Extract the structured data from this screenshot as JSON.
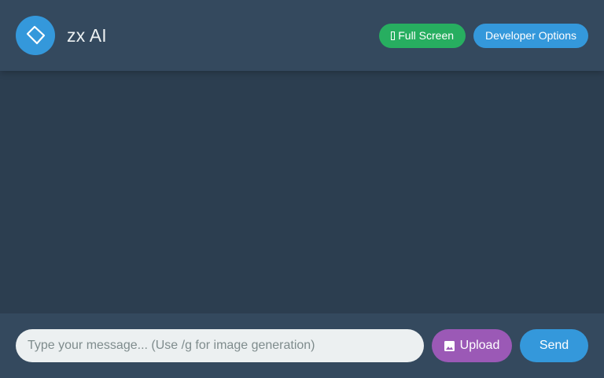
{
  "header": {
    "logo_icon": "diamond-logo-icon",
    "title": "zx AI",
    "fullscreen_label": "Full Screen",
    "fullscreen_icon": "fullscreen-icon",
    "developer_options_label": "Developer Options"
  },
  "chat": {
    "messages": []
  },
  "composer": {
    "placeholder": "Type your message... (Use /g for image generation)",
    "value": "",
    "upload_label": "Upload",
    "upload_icon": "image-icon",
    "send_label": "Send"
  },
  "colors": {
    "background": "#2c3e50",
    "panel": "#34495e",
    "accent_blue": "#3498db",
    "fullscreen_green": "#27ae60",
    "upload_purple": "#9b59b6",
    "input_bg": "#ecf0f1"
  }
}
